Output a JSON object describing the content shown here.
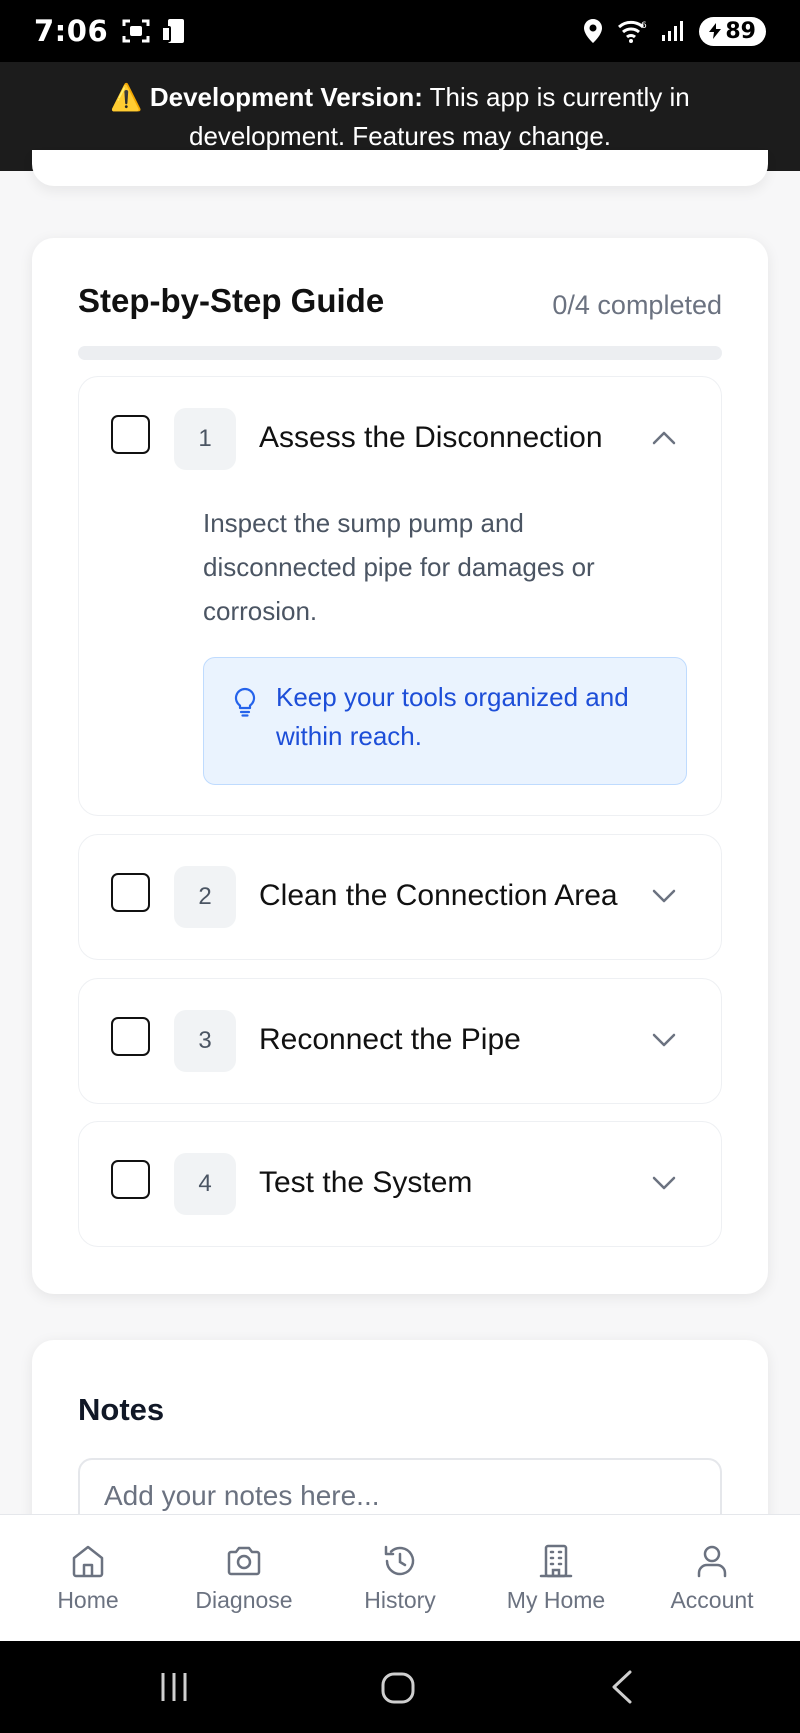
{
  "status_bar": {
    "time": "7:06",
    "battery": "89",
    "icons": [
      "screenshot-icon",
      "device-icon",
      "location-icon",
      "wifi-icon",
      "signal-icon",
      "battery-icon"
    ]
  },
  "banner": {
    "icon": "⚠️",
    "label": "Development Version:",
    "message": " This app is currently in development. Features may change."
  },
  "guide": {
    "title": "Step-by-Step Guide",
    "progress_text": "0/4 completed",
    "progress_fraction": 0,
    "steps": [
      {
        "number": "1",
        "title": "Assess the Disconnection",
        "expanded": true,
        "description": "Inspect the sump pump and disconnected pipe for damages or corrosion.",
        "tip": "Keep your tools organized and within reach."
      },
      {
        "number": "2",
        "title": "Clean the Connection Area",
        "expanded": false
      },
      {
        "number": "3",
        "title": "Reconnect the Pipe",
        "expanded": false
      },
      {
        "number": "4",
        "title": "Test the System",
        "expanded": false
      }
    ]
  },
  "notes": {
    "title": "Notes",
    "placeholder": "Add your notes here..."
  },
  "bottom_nav": [
    {
      "label": "Home",
      "icon": "home-icon"
    },
    {
      "label": "Diagnose",
      "icon": "camera-icon"
    },
    {
      "label": "History",
      "icon": "history-icon"
    },
    {
      "label": "My Home",
      "icon": "building-icon"
    },
    {
      "label": "Account",
      "icon": "user-icon"
    }
  ],
  "colors": {
    "accent": "#2563eb",
    "tip_background": "#eaf3fe",
    "tip_text": "#1d4ed8",
    "banner_background": "#1c1c1c"
  }
}
